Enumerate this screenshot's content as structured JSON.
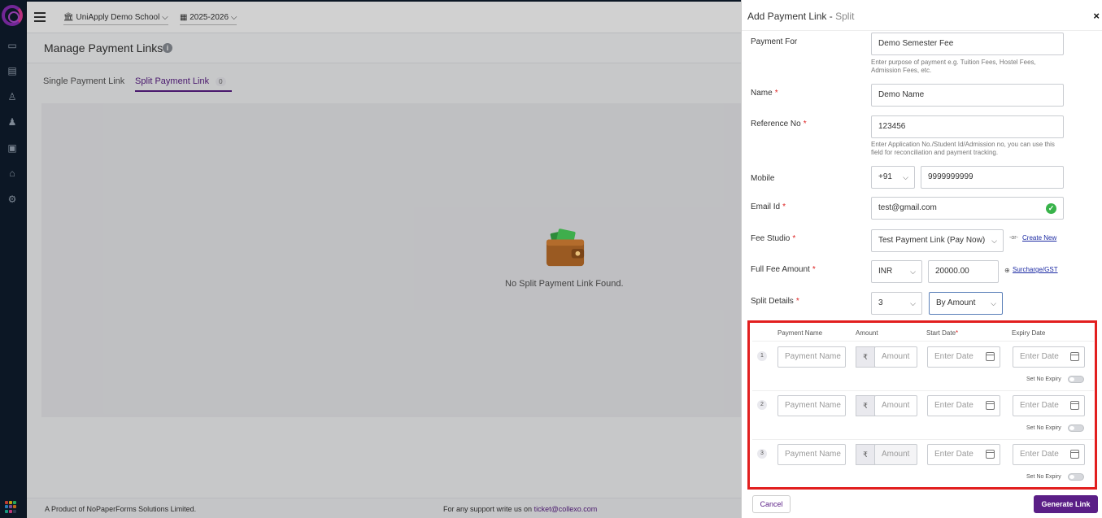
{
  "topbar": {
    "school": "UniApply Demo School",
    "session": "2025-2026"
  },
  "page": {
    "title": "Manage Payment Links",
    "tabs": [
      {
        "label": "Single Payment Link"
      },
      {
        "label": "Split Payment Link",
        "count": "0"
      }
    ],
    "empty_message": "No Split Payment Link Found."
  },
  "footer": {
    "product_prefix": "A Product of",
    "company": "NoPaperForms Solutions Limited.",
    "support_text": "For any support write us on",
    "support_email": "ticket@collexo.com"
  },
  "panel": {
    "title": "Add Payment Link -",
    "subtitle": "Split",
    "payment_for": {
      "label": "Payment For",
      "value": "Demo Semester Fee",
      "help": "Enter purpose of payment e.g. Tuition Fees, Hostel Fees, Admission Fees, etc."
    },
    "name": {
      "label": "Name",
      "value": "Demo Name"
    },
    "reference": {
      "label": "Reference No",
      "value": "123456",
      "help": "Enter Application No./Student Id/Admission no, you can use this field for reconciliation and payment tracking."
    },
    "mobile": {
      "label": "Mobile",
      "code": "+91",
      "value": "9999999999"
    },
    "email": {
      "label": "Email Id",
      "value": "test@gmail.com"
    },
    "fee_studio": {
      "label": "Fee Studio",
      "value": "Test Payment Link (Pay Now)",
      "or": "-or-",
      "create_new": "Create New"
    },
    "full_fee": {
      "label": "Full Fee Amount",
      "currency": "INR",
      "value": "20000.00",
      "surcharge": "Surcharge/GST"
    },
    "split_details": {
      "label": "Split Details",
      "count": "3",
      "mode": "By Amount"
    },
    "split_table": {
      "headers": {
        "payment_name": "Payment Name",
        "amount": "Amount",
        "start_date": "Start Date",
        "expiry_date": "Expiry Date"
      },
      "rows": [
        {
          "num": "1",
          "payment_name_ph": "Payment Name",
          "amount_ph": "Amount",
          "start_ph": "Enter Date",
          "expiry_ph": "Enter Date",
          "no_expiry": "Set No Expiry"
        },
        {
          "num": "2",
          "payment_name_ph": "Payment Name",
          "amount_ph": "Amount",
          "start_ph": "Enter Date",
          "expiry_ph": "Enter Date",
          "no_expiry": "Set No Expiry"
        },
        {
          "num": "3",
          "payment_name_ph": "Payment Name",
          "amount_ph": "Amount",
          "start_ph": "Enter Date",
          "expiry_ph": "Enter Date",
          "no_expiry": "Set No Expiry"
        }
      ],
      "currency_symbol": "₹"
    },
    "cancel": "Cancel",
    "generate": "Generate Link"
  }
}
